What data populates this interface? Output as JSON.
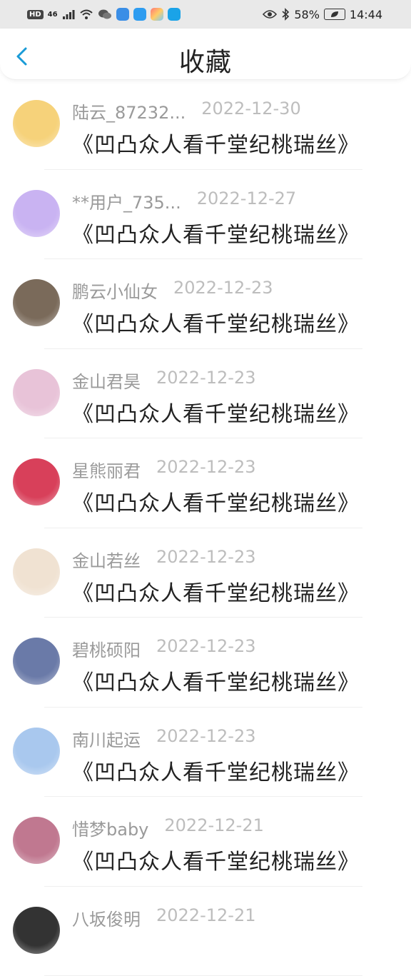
{
  "status_bar": {
    "network_badge": "HD",
    "signal_text": "46",
    "battery": "58%",
    "time": "14:44"
  },
  "header": {
    "title": "收藏"
  },
  "items": [
    {
      "user": "陆云_87232...",
      "date": "2022-12-30",
      "title": "《凹凸众人看千堂纪桃瑞丝》"
    },
    {
      "user": "**用户_735...",
      "date": "2022-12-27",
      "title": "《凹凸众人看千堂纪桃瑞丝》"
    },
    {
      "user": "鹏云小仙女",
      "date": "2022-12-23",
      "title": "《凹凸众人看千堂纪桃瑞丝》"
    },
    {
      "user": "金山君昊",
      "date": "2022-12-23",
      "title": "《凹凸众人看千堂纪桃瑞丝》"
    },
    {
      "user": "星熊丽君",
      "date": "2022-12-23",
      "title": "《凹凸众人看千堂纪桃瑞丝》"
    },
    {
      "user": "金山若丝",
      "date": "2022-12-23",
      "title": "《凹凸众人看千堂纪桃瑞丝》"
    },
    {
      "user": "碧桃硕阳",
      "date": "2022-12-23",
      "title": "《凹凸众人看千堂纪桃瑞丝》"
    },
    {
      "user": "南川起运",
      "date": "2022-12-23",
      "title": "《凹凸众人看千堂纪桃瑞丝》"
    },
    {
      "user": "惜梦baby",
      "date": "2022-12-21",
      "title": "《凹凸众人看千堂纪桃瑞丝》"
    },
    {
      "user": "八坂俊明",
      "date": "2022-12-21",
      "title": ""
    }
  ],
  "colors": {
    "accent": "#1a9bd7",
    "avatar_colors": [
      "#f6d27a",
      "#c9b3f2",
      "#7a6a5a",
      "#e8c3d8",
      "#d8405a",
      "#f0e2d2",
      "#6a7aa8",
      "#a9c8ee",
      "#c07890",
      "#333333"
    ]
  }
}
